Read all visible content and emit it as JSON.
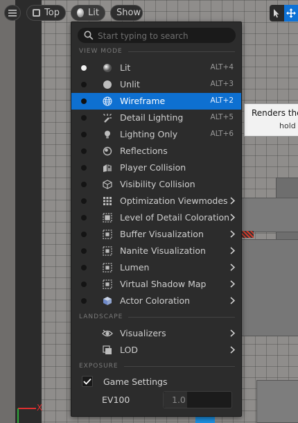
{
  "toolbar": {
    "camera_label": "Top",
    "lit_label": "Lit",
    "show_label": "Show"
  },
  "tooltip": {
    "line1": "Renders the",
    "line2": "hold ("
  },
  "menu": {
    "search_placeholder": "Start typing to search",
    "sections": {
      "view_mode": "VIEW MODE",
      "landscape": "LANDSCAPE",
      "exposure": "EXPOSURE"
    },
    "view_modes": [
      {
        "label": "Lit",
        "shortcut": "ALT+4",
        "icon": "lit-sphere-icon"
      },
      {
        "label": "Unlit",
        "shortcut": "ALT+3",
        "icon": "unlit-sphere-icon"
      },
      {
        "label": "Wireframe",
        "shortcut": "ALT+2",
        "icon": "wireframe-sphere-icon"
      },
      {
        "label": "Detail Lighting",
        "shortcut": "ALT+5",
        "icon": "detail-lighting-icon"
      },
      {
        "label": "Lighting Only",
        "shortcut": "ALT+6",
        "icon": "light-bulb-icon"
      },
      {
        "label": "Reflections",
        "shortcut": "",
        "icon": "reflections-icon"
      },
      {
        "label": "Player Collision",
        "shortcut": "",
        "icon": "player-collision-icon"
      },
      {
        "label": "Visibility Collision",
        "shortcut": "",
        "icon": "visibility-collision-icon"
      },
      {
        "label": "Optimization Viewmodes",
        "shortcut": "",
        "icon": "grid-icon"
      },
      {
        "label": "Level of Detail Coloration",
        "shortcut": "",
        "icon": "lod-coloration-icon"
      },
      {
        "label": "Buffer Visualization",
        "shortcut": "",
        "icon": "buffer-icon"
      },
      {
        "label": "Nanite Visualization",
        "shortcut": "",
        "icon": "nanite-icon"
      },
      {
        "label": "Lumen",
        "shortcut": "",
        "icon": "lumen-icon"
      },
      {
        "label": "Virtual Shadow Map",
        "shortcut": "",
        "icon": "shadow-map-icon"
      },
      {
        "label": "Actor Coloration",
        "shortcut": "",
        "icon": "actor-cube-icon"
      }
    ],
    "landscape_items": [
      {
        "label": "Visualizers",
        "icon": "eye-icon"
      },
      {
        "label": "LOD",
        "icon": "lod-icon"
      }
    ],
    "exposure": {
      "game_settings_label": "Game Settings",
      "game_settings_checked": true,
      "ev100_label": "EV100",
      "ev100_value": "1.0"
    }
  },
  "axis": {
    "x_label": "X"
  },
  "colors": {
    "selection": "#0e70d1",
    "menu_bg": "#2c2c2c",
    "accent_red": "#e03030"
  }
}
